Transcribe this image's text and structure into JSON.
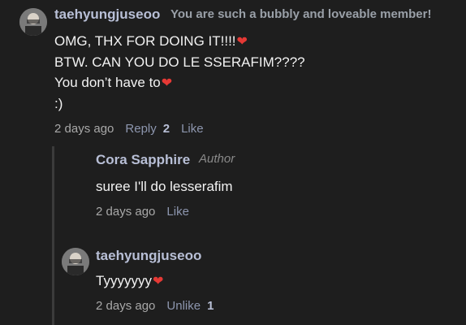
{
  "comment": {
    "username": "taehyungjuseoo",
    "member_text": "You are such a bubbly and loveable member!",
    "lines": [
      "OMG, THX FOR DOING IT!!!!",
      "BTW. CAN YOU DO LE SSERAFIM????",
      "You don’t have to",
      ":)"
    ],
    "time": "2 days ago",
    "reply_label": "Reply",
    "reply_count": "2",
    "like_label": "Like"
  },
  "replies": [
    {
      "username": "Cora Sapphire",
      "badge": "Author",
      "text": "suree I'll do lesserafim",
      "time": "2 days ago",
      "like_label": "Like"
    },
    {
      "username": "taehyungjuseoo",
      "text": "Tyyyyyyy",
      "time": "2 days ago",
      "like_label": "Unlike",
      "like_count": "1"
    }
  ],
  "colors": {
    "background": "#1e1e1e",
    "username": "#b8bfd6",
    "link": "#8d96ae",
    "heart": "#e53935"
  },
  "icons": {
    "heart": "heart-icon",
    "avatar": "user-avatar"
  }
}
